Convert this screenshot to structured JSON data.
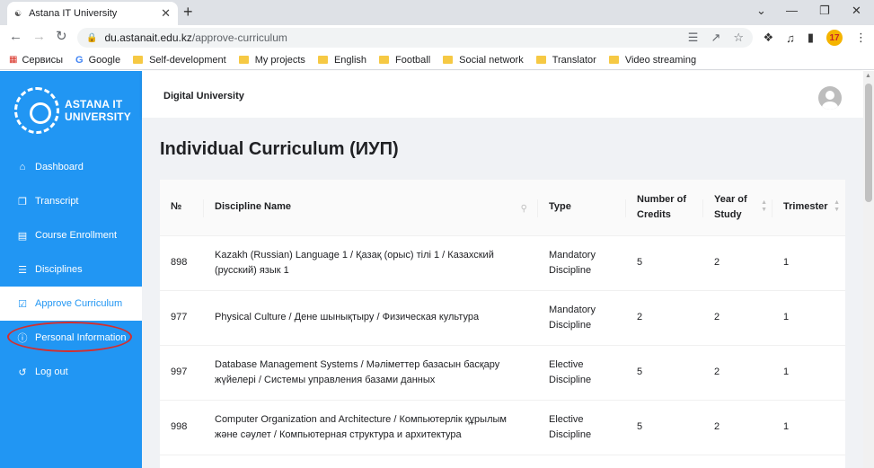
{
  "browser": {
    "tab_title": "Astana IT University",
    "tab_favicon_icon": "aitu-favicon",
    "url_host": "du.astanait.edu.kz",
    "url_path": "/approve-curriculum",
    "extension_badge": "17",
    "bookmarks": [
      {
        "label": "Сервисы",
        "icon": "apps-grid-icon"
      },
      {
        "label": "Google",
        "icon": "google-g-icon"
      },
      {
        "label": "Self-development",
        "icon": "folder-icon"
      },
      {
        "label": "My projects",
        "icon": "folder-icon"
      },
      {
        "label": "English",
        "icon": "folder-icon"
      },
      {
        "label": "Football",
        "icon": "folder-icon"
      },
      {
        "label": "Social network",
        "icon": "folder-icon"
      },
      {
        "label": "Translator",
        "icon": "folder-icon"
      },
      {
        "label": "Video streaming",
        "icon": "folder-icon"
      }
    ]
  },
  "sidebar": {
    "logo_line1": "ASTANA IT",
    "logo_line2": "UNIVERSITY",
    "items": [
      {
        "label": "Dashboard",
        "icon": "home-icon"
      },
      {
        "label": "Transcript",
        "icon": "copy-icon"
      },
      {
        "label": "Course Enrollment",
        "icon": "file-icon"
      },
      {
        "label": "Disciplines",
        "icon": "list-icon"
      },
      {
        "label": "Approve Curriculum",
        "icon": "check-square-icon"
      },
      {
        "label": "Personal Information",
        "icon": "info-icon"
      },
      {
        "label": "Log out",
        "icon": "logout-icon"
      }
    ],
    "active_item": "Approve Curriculum",
    "highlighted_item": "Personal Information"
  },
  "header": {
    "brand": "Digital University"
  },
  "main": {
    "title": "Individual Curriculum (ИУП)",
    "table": {
      "columns": [
        "№",
        "Discipline Name",
        "Type",
        "Number of Credits",
        "Year of Study",
        "Trimester"
      ],
      "rows": [
        {
          "no": "898",
          "name": "Kazakh (Russian) Language 1 / Қазақ (орыс) тілі 1 / Казахский (русский) язык 1",
          "type": "Mandatory Discipline",
          "credits": "5",
          "year": "2",
          "trimester": "1"
        },
        {
          "no": "977",
          "name": "Physical Culture / Дене шынықтыру / Физическая культура",
          "type": "Mandatory Discipline",
          "credits": "2",
          "year": "2",
          "trimester": "1"
        },
        {
          "no": "997",
          "name": "Database Management Systems / Мәліметтер базасын басқару жүйелері / Системы управления базами данных",
          "type": "Elective Discipline",
          "credits": "5",
          "year": "2",
          "trimester": "1"
        },
        {
          "no": "998",
          "name": "Computer Organization and Architecture / Компьютерлік құрылым және сәулет / Компьютерная структура и архитектура",
          "type": "Elective Discipline",
          "credits": "5",
          "year": "2",
          "trimester": "1"
        }
      ]
    }
  },
  "colors": {
    "sidebar_bg": "#2196f3",
    "annotation_red": "#d32f2f"
  }
}
